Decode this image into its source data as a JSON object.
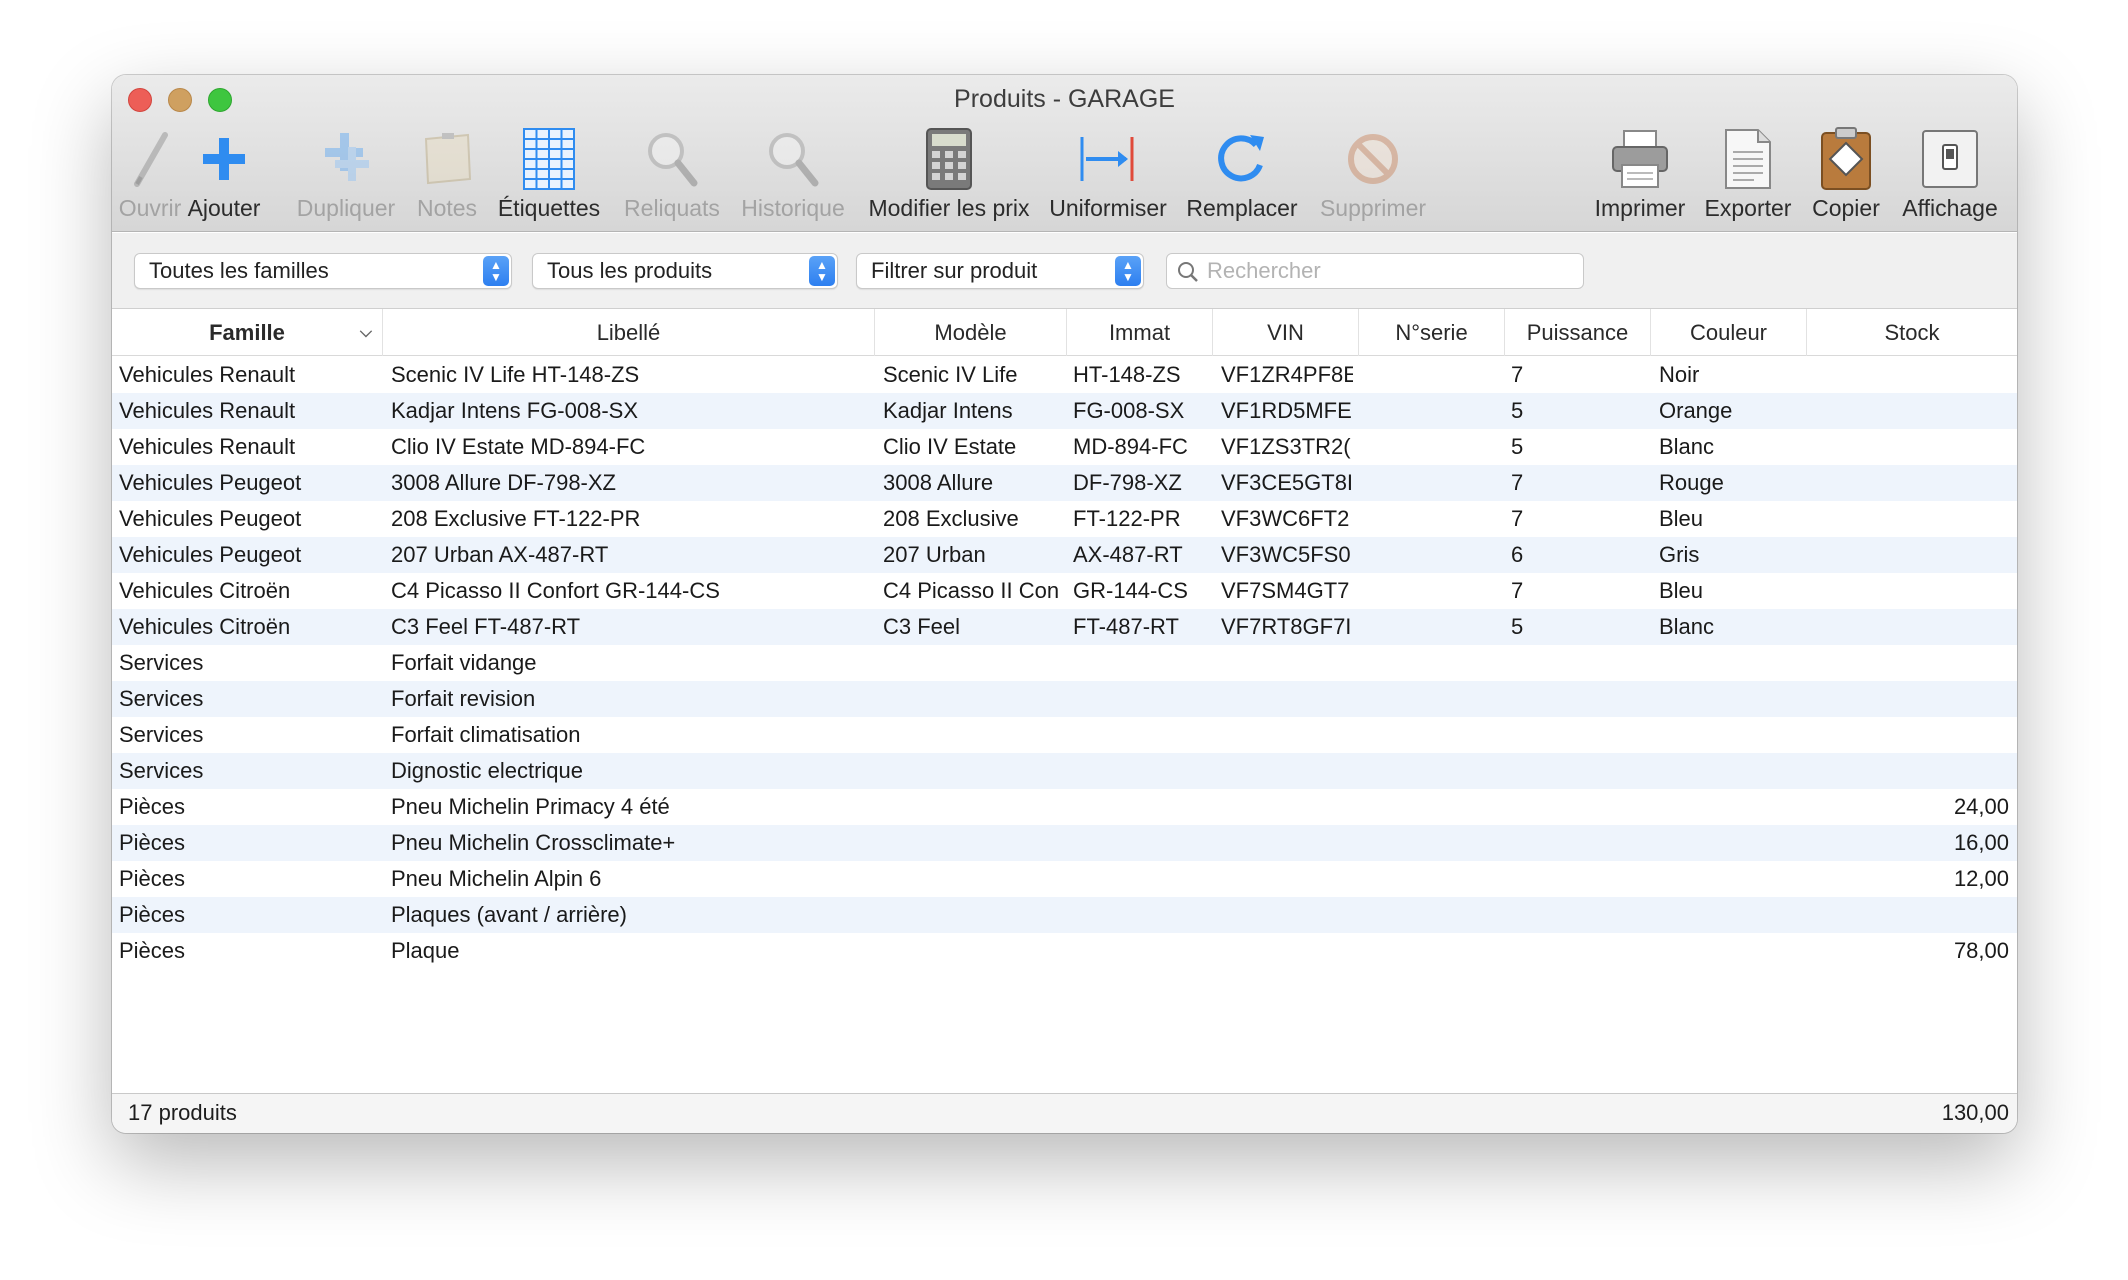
{
  "window": {
    "title": "Produits - GARAGE"
  },
  "toolbar": {
    "open": "Ouvrir",
    "add": "Ajouter",
    "duplicate": "Dupliquer",
    "notes": "Notes",
    "labels": "Étiquettes",
    "backorders": "Reliquats",
    "history": "Historique",
    "edit_prices": "Modifier les prix",
    "standardize": "Uniformiser",
    "replace": "Remplacer",
    "delete": "Supprimer",
    "print": "Imprimer",
    "export": "Exporter",
    "copy": "Copier",
    "display": "Affichage"
  },
  "filters": {
    "family": "Toutes les familles",
    "products": "Tous les produits",
    "filter": "Filtrer sur produit",
    "search_placeholder": "Rechercher"
  },
  "columns": {
    "famille": "Famille",
    "libelle": "Libellé",
    "modele": "Modèle",
    "immat": "Immat",
    "vin": "VIN",
    "serie": "N°serie",
    "puissance": "Puissance",
    "couleur": "Couleur",
    "stock": "Stock"
  },
  "rows": [
    {
      "famille": "Vehicules Renault",
      "libelle": "Scenic IV Life  HT-148-ZS",
      "modele": "Scenic IV Life",
      "immat": "HT-148-ZS",
      "vin": "VF1ZR4PF8E",
      "serie": "",
      "puissance": "7",
      "couleur": "Noir",
      "stock": ""
    },
    {
      "famille": "Vehicules Renault",
      "libelle": "Kadjar Intens  FG-008-SX",
      "modele": "Kadjar Intens",
      "immat": "FG-008-SX",
      "vin": "VF1RD5MFE",
      "serie": "",
      "puissance": "5",
      "couleur": "Orange",
      "stock": ""
    },
    {
      "famille": "Vehicules Renault",
      "libelle": "Clio IV Estate MD-894-FC",
      "modele": "Clio IV Estate",
      "immat": "MD-894-FC",
      "vin": "VF1ZS3TR2(",
      "serie": "",
      "puissance": "5",
      "couleur": "Blanc",
      "stock": ""
    },
    {
      "famille": "Vehicules Peugeot",
      "libelle": "3008 Allure DF-798-XZ",
      "modele": "3008 Allure",
      "immat": "DF-798-XZ",
      "vin": "VF3CE5GT8I",
      "serie": "",
      "puissance": "7",
      "couleur": "Rouge",
      "stock": ""
    },
    {
      "famille": "Vehicules Peugeot",
      "libelle": "208 Exclusive FT-122-PR",
      "modele": "208 Exclusive",
      "immat": "FT-122-PR",
      "vin": "VF3WC6FT2",
      "serie": "",
      "puissance": "7",
      "couleur": "Bleu",
      "stock": ""
    },
    {
      "famille": "Vehicules Peugeot",
      "libelle": "207 Urban AX-487-RT",
      "modele": "207 Urban",
      "immat": "AX-487-RT",
      "vin": "VF3WC5FS0",
      "serie": "",
      "puissance": "6",
      "couleur": "Gris",
      "stock": ""
    },
    {
      "famille": "Vehicules Citroën",
      "libelle": "C4 Picasso II Confort GR-144-CS",
      "modele": "C4 Picasso II Con",
      "immat": "GR-144-CS",
      "vin": "VF7SM4GT7",
      "serie": "",
      "puissance": "7",
      "couleur": "Bleu",
      "stock": ""
    },
    {
      "famille": "Vehicules Citroën",
      "libelle": "C3 Feel FT-487-RT",
      "modele": "C3 Feel",
      "immat": "FT-487-RT",
      "vin": "VF7RT8GF7I",
      "serie": "",
      "puissance": "5",
      "couleur": "Blanc",
      "stock": ""
    },
    {
      "famille": "Services",
      "libelle": "Forfait vidange",
      "modele": "",
      "immat": "",
      "vin": "",
      "serie": "",
      "puissance": "",
      "couleur": "",
      "stock": ""
    },
    {
      "famille": "Services",
      "libelle": "Forfait revision",
      "modele": "",
      "immat": "",
      "vin": "",
      "serie": "",
      "puissance": "",
      "couleur": "",
      "stock": ""
    },
    {
      "famille": "Services",
      "libelle": "Forfait climatisation",
      "modele": "",
      "immat": "",
      "vin": "",
      "serie": "",
      "puissance": "",
      "couleur": "",
      "stock": ""
    },
    {
      "famille": "Services",
      "libelle": "Dignostic electrique",
      "modele": "",
      "immat": "",
      "vin": "",
      "serie": "",
      "puissance": "",
      "couleur": "",
      "stock": ""
    },
    {
      "famille": "Pièces",
      "libelle": "Pneu Michelin Primacy 4 été",
      "modele": "",
      "immat": "",
      "vin": "",
      "serie": "",
      "puissance": "",
      "couleur": "",
      "stock": "24,00"
    },
    {
      "famille": "Pièces",
      "libelle": "Pneu Michelin Crossclimate+",
      "modele": "",
      "immat": "",
      "vin": "",
      "serie": "",
      "puissance": "",
      "couleur": "",
      "stock": "16,00"
    },
    {
      "famille": "Pièces",
      "libelle": "Pneu Michelin Alpin 6",
      "modele": "",
      "immat": "",
      "vin": "",
      "serie": "",
      "puissance": "",
      "couleur": "",
      "stock": "12,00"
    },
    {
      "famille": "Pièces",
      "libelle": "Plaques (avant / arrière)",
      "modele": "",
      "immat": "",
      "vin": "",
      "serie": "",
      "puissance": "",
      "couleur": "",
      "stock": ""
    },
    {
      "famille": "Pièces",
      "libelle": "Plaque",
      "modele": "",
      "immat": "",
      "vin": "",
      "serie": "",
      "puissance": "",
      "couleur": "",
      "stock": "78,00"
    }
  ],
  "status": {
    "count": "17 produits",
    "total": "130,00"
  },
  "colors": {
    "accent": "#2d7ff0",
    "row_alt": "#eef4fc",
    "disabled_text": "#a3a3a3"
  }
}
